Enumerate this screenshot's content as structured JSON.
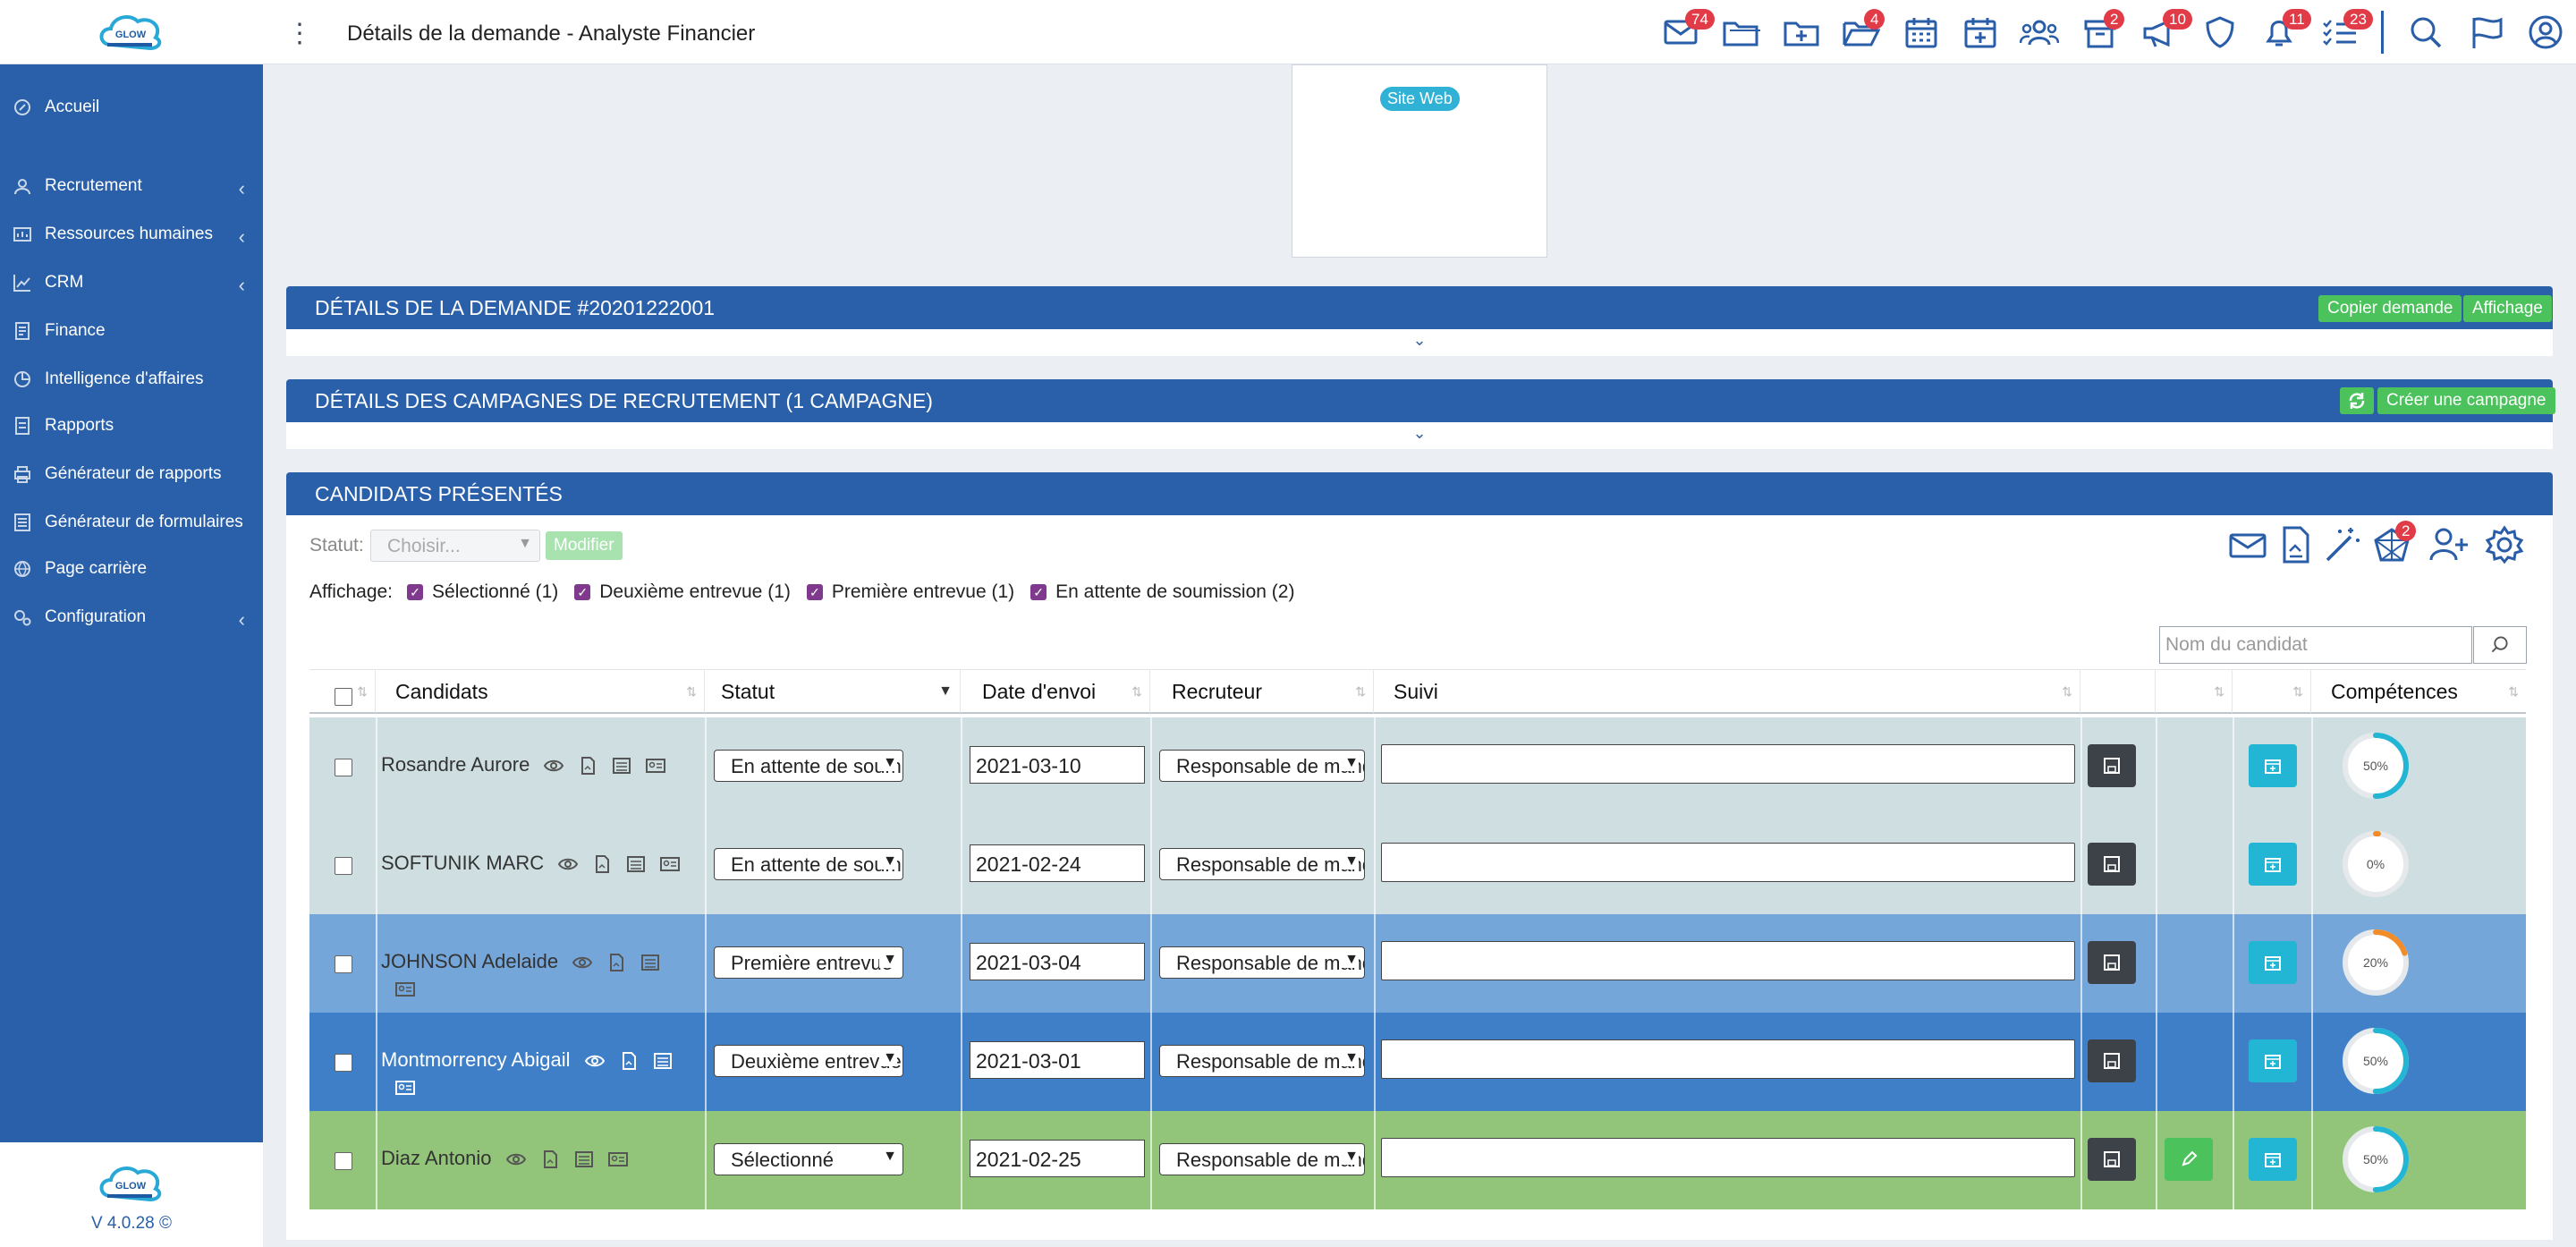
{
  "app": {
    "logo_text": "GLOW",
    "page_title": "Détails de la demande - Analyste Financier",
    "version": "V 4.0.28 ©"
  },
  "topbar_icons": [
    {
      "name": "mail-icon",
      "badge": "74"
    },
    {
      "name": "folder-icon",
      "badge": ""
    },
    {
      "name": "folder-add-icon",
      "badge": "4"
    },
    {
      "name": "folder-open-icon",
      "badge": ""
    },
    {
      "name": "calendar-icon",
      "badge": ""
    },
    {
      "name": "calendar-add-icon",
      "badge": ""
    },
    {
      "name": "users-icon",
      "badge": "2"
    },
    {
      "name": "archive-icon",
      "badge": ""
    },
    {
      "name": "megaphone-icon",
      "badge": "10"
    },
    {
      "name": "shield-icon",
      "badge": ""
    },
    {
      "name": "bell-icon",
      "badge": "11"
    },
    {
      "name": "task-list-icon",
      "badge": "23"
    },
    {
      "name": "search-icon",
      "badge": ""
    },
    {
      "name": "flag-icon",
      "badge": ""
    },
    {
      "name": "user-icon",
      "badge": ""
    }
  ],
  "sidebar": {
    "items": [
      {
        "label": "Accueil",
        "icon": "home-icon",
        "has_children": false
      },
      {
        "label": "Recrutement",
        "icon": "recruitment-icon",
        "has_children": true
      },
      {
        "label": "Ressources humaines",
        "icon": "hr-icon",
        "has_children": true
      },
      {
        "label": "CRM",
        "icon": "chart-icon",
        "has_children": true
      },
      {
        "label": "Finance",
        "icon": "finance-icon",
        "has_children": false
      },
      {
        "label": "Intelligence d'affaires",
        "icon": "bi-icon",
        "has_children": false
      },
      {
        "label": "Rapports",
        "icon": "report-icon",
        "has_children": false
      },
      {
        "label": "Générateur de rapports",
        "icon": "printer-icon",
        "has_children": false
      },
      {
        "label": "Générateur de formulaires",
        "icon": "form-icon",
        "has_children": false
      },
      {
        "label": "Page carrière",
        "icon": "globe-icon",
        "has_children": false
      },
      {
        "label": "Configuration",
        "icon": "gears-icon",
        "has_children": true
      }
    ]
  },
  "website_card": {
    "label": "Site Web"
  },
  "panels": {
    "demande": {
      "title": "DÉTAILS DE LA DEMANDE #20201222001",
      "copy_label": "Copier demande",
      "display_label": "Affichage"
    },
    "campagnes": {
      "title": "DÉTAILS DES CAMPAGNES DE RECRUTEMENT (1 CAMPAGNE)",
      "create_label": "Créer une campagne"
    },
    "candidats": {
      "title": "CANDIDATS PRÉSENTÉS"
    }
  },
  "filters": {
    "statut_label": "Statut:",
    "statut_placeholder": "Choisir...",
    "modify_label": "Modifier",
    "affichage_label": "Affichage:",
    "checkboxes": [
      {
        "label": "Sélectionné (1)",
        "checked": true
      },
      {
        "label": "Deuxième entrevue (1)",
        "checked": true
      },
      {
        "label": "Première entrevue (1)",
        "checked": true
      },
      {
        "label": "En attente de soumission (2)",
        "checked": true
      }
    ],
    "search_placeholder": "Nom du candidat"
  },
  "toolbar_icons": [
    {
      "name": "email-icon",
      "badge": ""
    },
    {
      "name": "document-icon",
      "badge": ""
    },
    {
      "name": "magic-wand-icon",
      "badge": ""
    },
    {
      "name": "network-icon",
      "badge": "2"
    },
    {
      "name": "user-add-icon",
      "badge": ""
    },
    {
      "name": "settings-icon",
      "badge": ""
    }
  ],
  "table": {
    "columns": [
      "Candidats",
      "Statut",
      "Date d'envoi",
      "Recruteur",
      "Suivi",
      "",
      "",
      "Compétences"
    ],
    "rows": [
      {
        "name": "Rosandre Aurore",
        "status": "En attente de soumission",
        "date": "2021-03-10",
        "recruiter": "Responsable de mandat",
        "suivi": "",
        "competence": 50,
        "competence_label": "50%",
        "row_color": "#cfdfe1",
        "name_color": "#333333",
        "ring_color": "#22b6d4",
        "editable": false
      },
      {
        "name": "SOFTUNIK MARC",
        "status": "En attente de soumission",
        "date": "2021-02-24",
        "recruiter": "Responsable de mandat",
        "suivi": "",
        "competence": 0,
        "competence_label": "0%",
        "row_color": "#cfdfe1",
        "name_color": "#333333",
        "ring_color": "#f28c28",
        "editable": false
      },
      {
        "name": "JOHNSON Adelaide",
        "status": "Première entrevue",
        "date": "2021-03-04",
        "recruiter": "Responsable de mandat",
        "suivi": "",
        "competence": 20,
        "competence_label": "20%",
        "row_color": "#74a6da",
        "name_color": "#333333",
        "ring_color": "#f28c28",
        "editable": false
      },
      {
        "name": "Montmorrency Abigail",
        "status": "Deuxième entrevue",
        "date": "2021-03-01",
        "recruiter": "Responsable de mandat",
        "suivi": "",
        "competence": 50,
        "competence_label": "50%",
        "row_color": "#3f7fc7",
        "name_color": "#ffffff",
        "ring_color": "#22b6d4",
        "editable": false
      },
      {
        "name": "Diaz Antonio",
        "status": "Sélectionné",
        "date": "2021-02-25",
        "recruiter": "Responsable de mandat",
        "suivi": "",
        "competence": 50,
        "competence_label": "50%",
        "row_color": "#92c57a",
        "name_color": "#333333",
        "ring_color": "#22b6d4",
        "editable": true
      }
    ]
  }
}
